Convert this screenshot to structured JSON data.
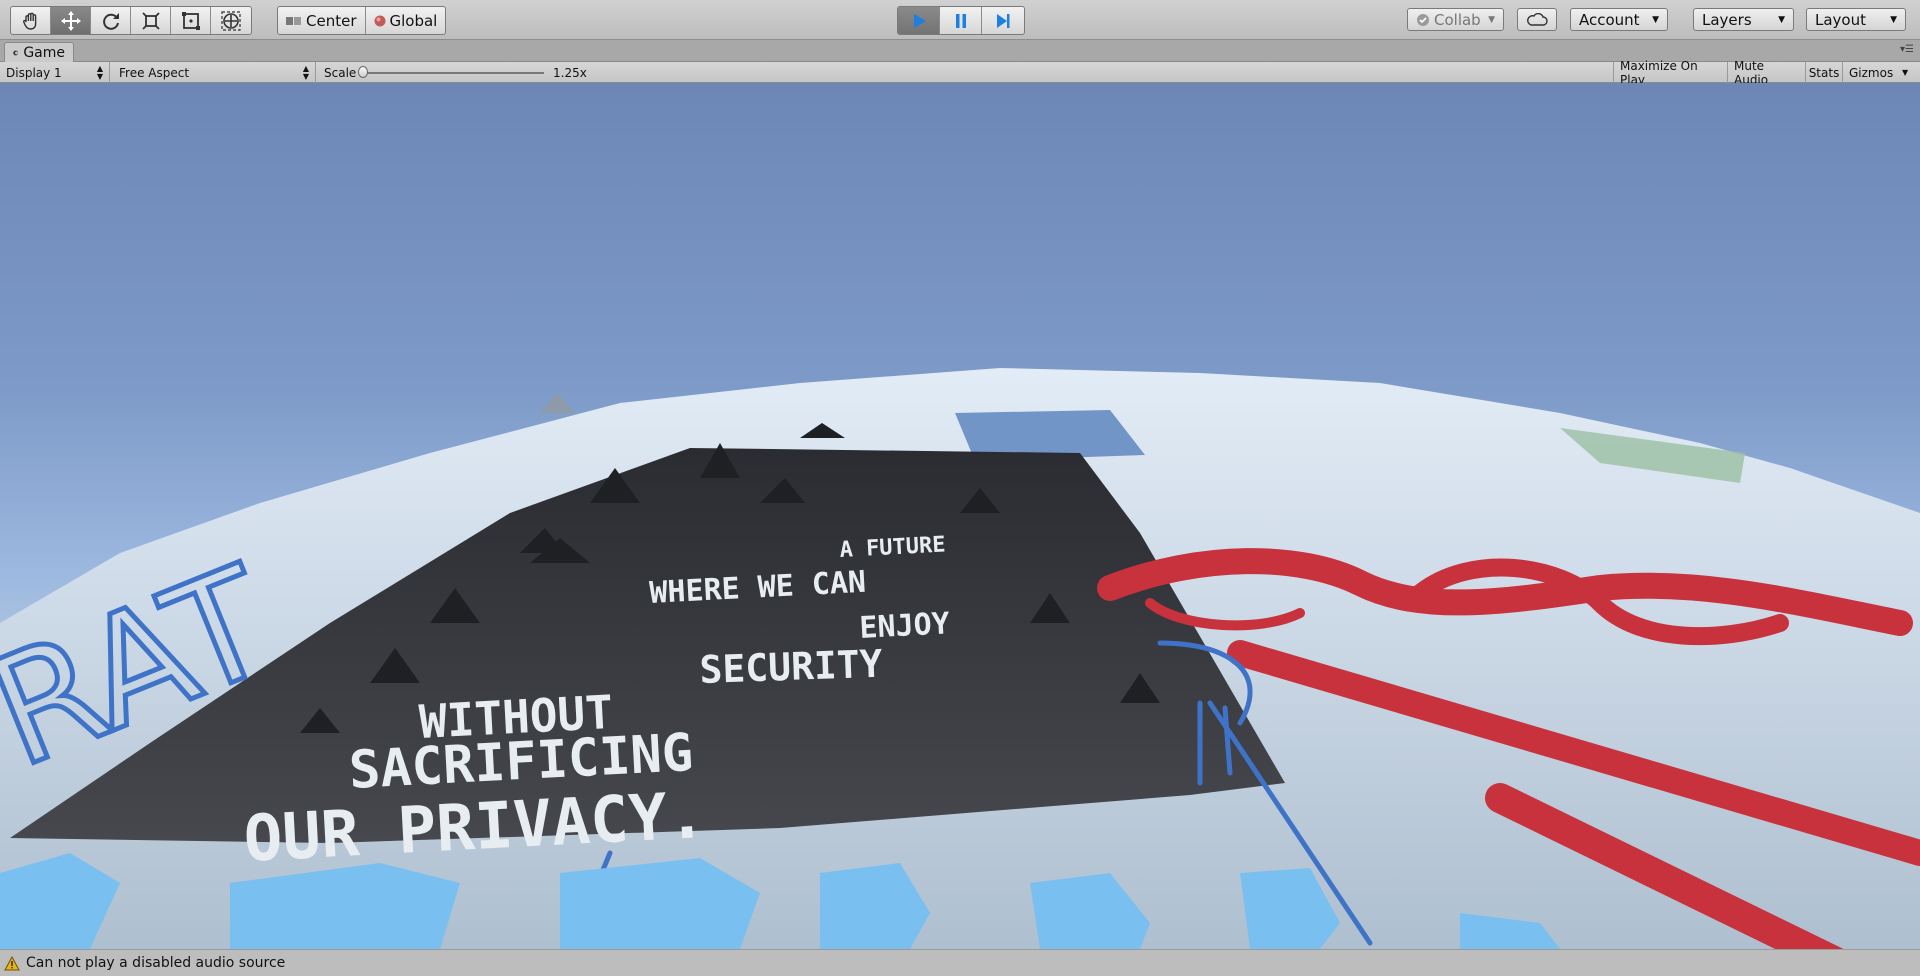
{
  "toolbar": {
    "tools": [
      "hand-tool",
      "move-tool",
      "rotate-tool",
      "scale-tool",
      "rect-tool",
      "transform-tool"
    ],
    "pivot_mode": "Center",
    "pivot_rotation": "Global",
    "collab": "Collab",
    "account": "Account",
    "layers": "Layers",
    "layout": "Layout"
  },
  "tab": {
    "title": "Game"
  },
  "game_toolbar": {
    "display": "Display 1",
    "aspect": "Free Aspect",
    "scale_label": "Scale",
    "scale_value": "1.25x",
    "maximize_on_play": "Maximize On Play",
    "mute_audio": "Mute Audio",
    "stats": "Stats",
    "gizmos": "Gizmos"
  },
  "scene": {
    "poster_lines": [
      "A FUTURE",
      "WHERE WE CAN",
      "ENJOY",
      "SECURITY",
      "WITHOUT",
      "SACRIFICING",
      "OUR PRIVACY."
    ],
    "graffiti_left": "RAT",
    "colors": {
      "sky_top": "#6d86b6",
      "sky_horizon": "#b6cbe4",
      "poster": "#3b3d42",
      "graffiti_red": "#c8323c",
      "graffiti_blue": "#3f73c8",
      "paint_light_blue": "#79c0f0"
    }
  },
  "status": {
    "message": "Can not play a disabled audio source"
  }
}
